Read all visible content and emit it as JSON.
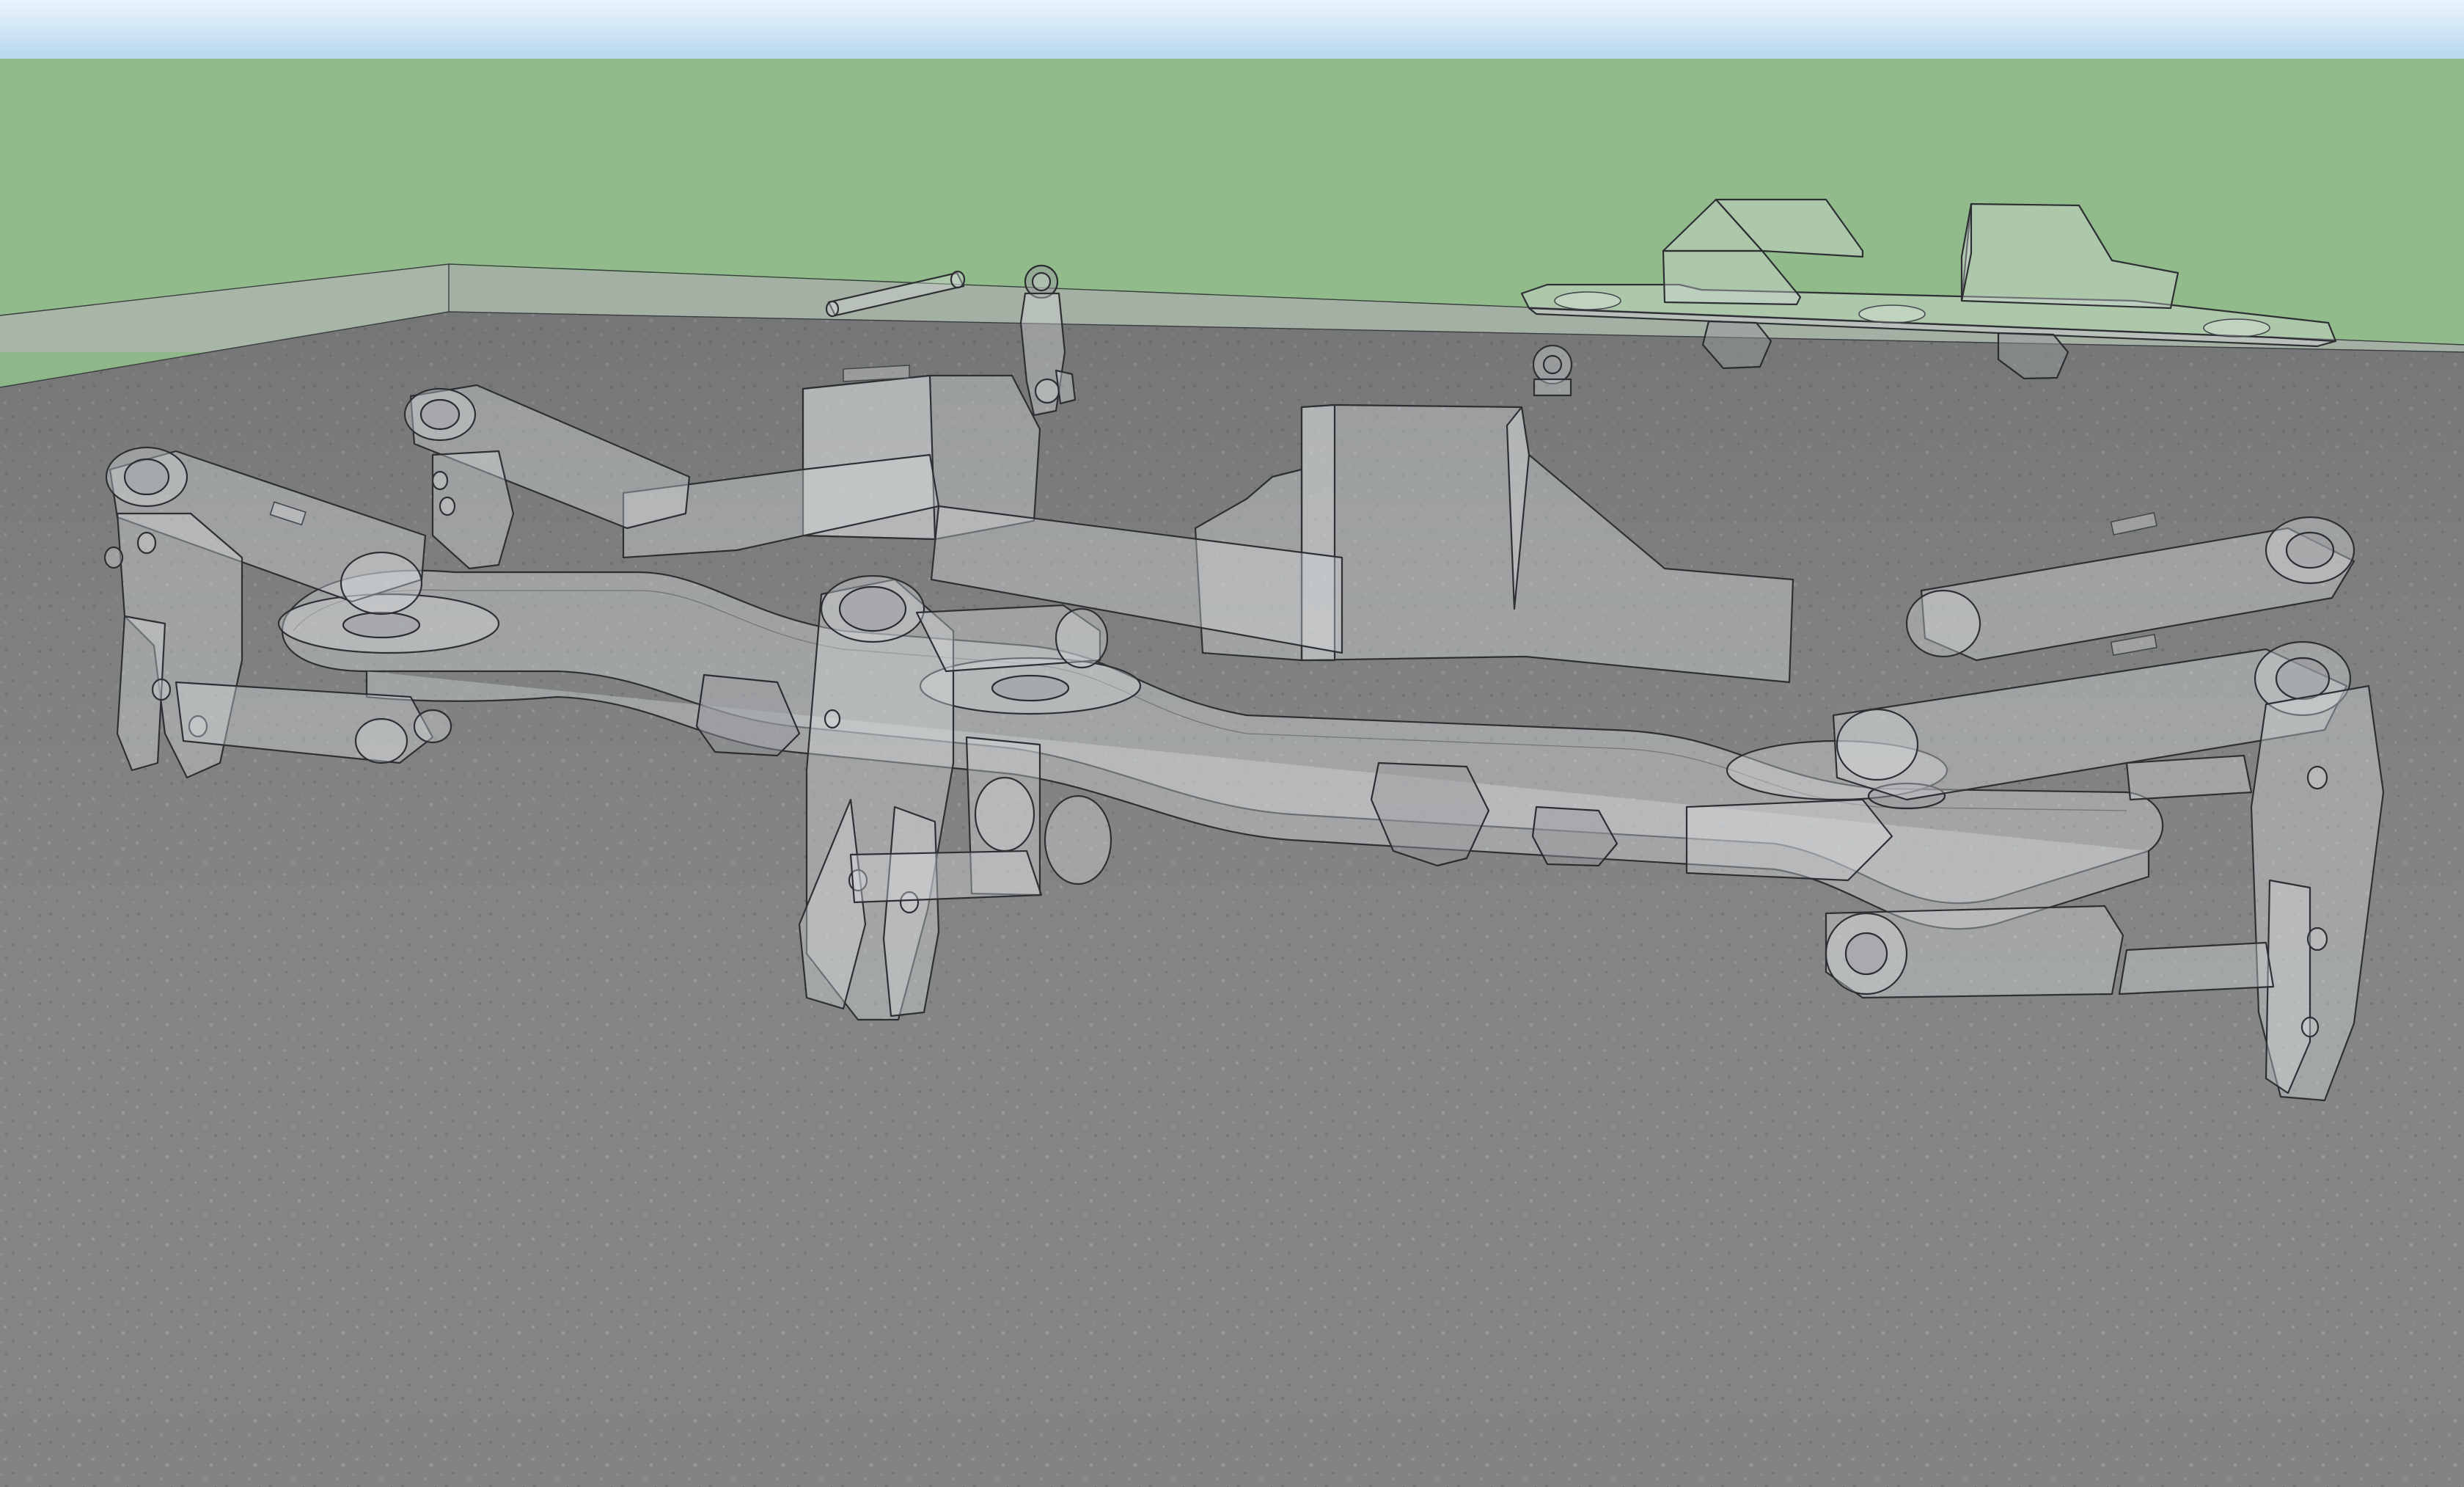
{
  "scene": {
    "colors": {
      "sky_top": "#e6f2fb",
      "sky_bottom": "#b9d9ef",
      "field": "#92bb8b",
      "ground": "#7a7c7b",
      "wall_top": "#b3bfb2",
      "wall_face": "#a6b2a5",
      "edges": "#2d2f33"
    },
    "objects": [
      {
        "name": "main-body-assembly",
        "icon": "robot-chassis-icon"
      },
      {
        "name": "top-plate-assembly",
        "icon": "plate-icon"
      },
      {
        "name": "loose-pin",
        "icon": "pin-icon"
      },
      {
        "name": "loose-link-arm",
        "icon": "link-icon"
      },
      {
        "name": "loose-eyelet",
        "icon": "eyelet-icon"
      }
    ]
  }
}
